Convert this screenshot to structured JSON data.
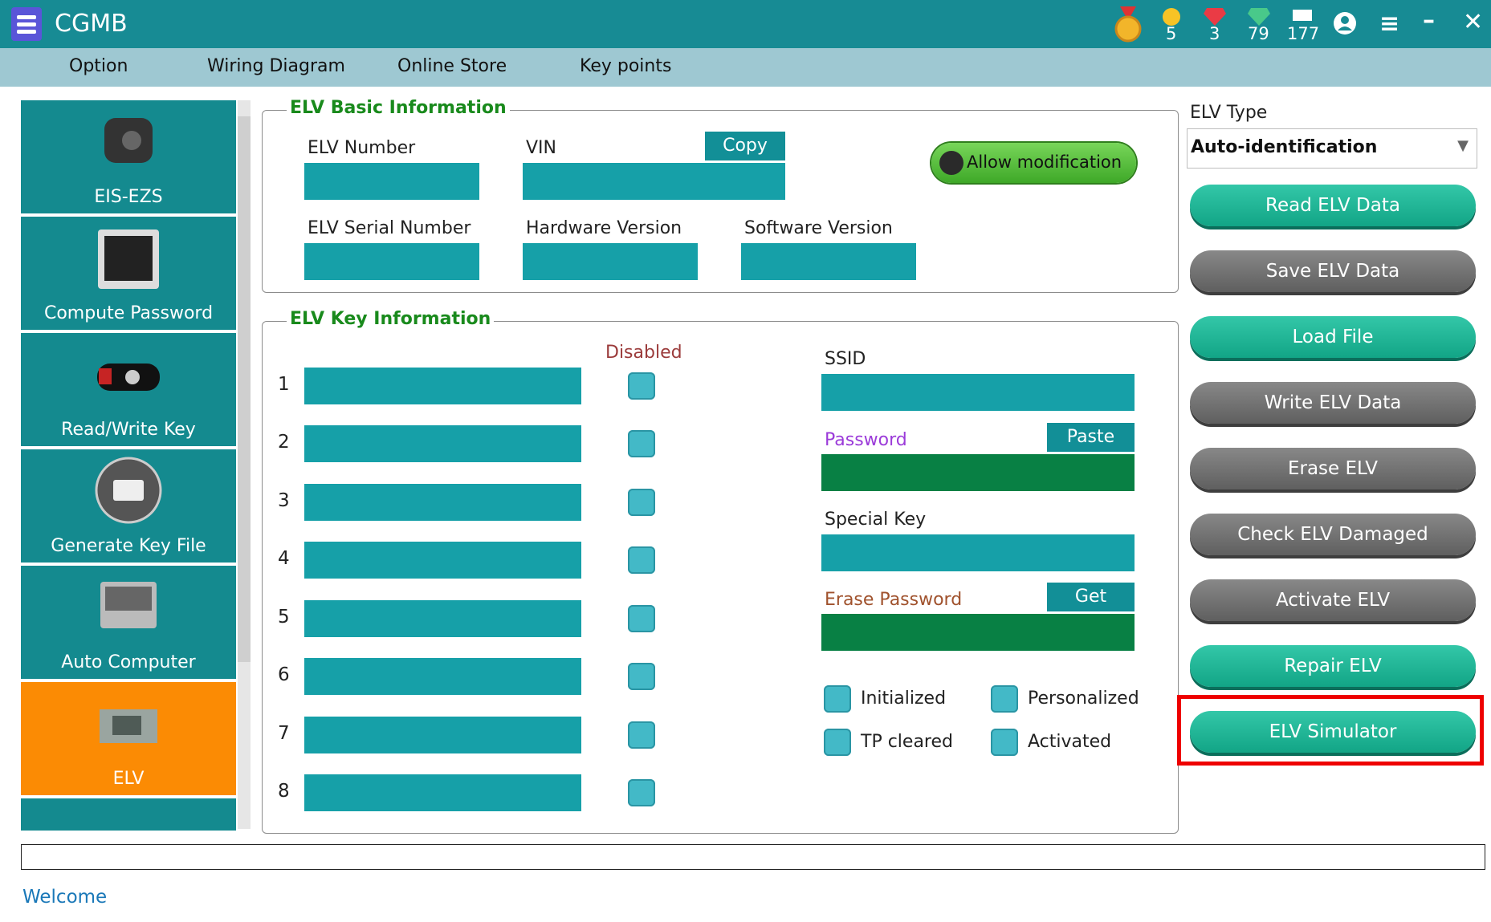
{
  "app": {
    "title": "CGMB"
  },
  "titlebar": {
    "counters": [
      {
        "icon": "medal-icon",
        "value": ""
      },
      {
        "icon": "gold-coin-icon",
        "value": "5"
      },
      {
        "icon": "red-gem-icon",
        "value": "3"
      },
      {
        "icon": "green-gem-icon",
        "value": "79"
      },
      {
        "icon": "chip-icon",
        "value": "177"
      }
    ]
  },
  "menu": {
    "items": [
      "Option",
      "Wiring Diagram",
      "Online Store",
      "Key points"
    ]
  },
  "sidebar": {
    "items": [
      {
        "label": "EIS-EZS",
        "icon": "ignition-switch-icon"
      },
      {
        "label": "Compute Password",
        "icon": "binary-chip-icon"
      },
      {
        "label": "Read/Write Key",
        "icon": "car-key-icon"
      },
      {
        "label": "Generate Key File",
        "icon": "printer-icon"
      },
      {
        "label": "Auto Computer",
        "icon": "ecu-icon"
      },
      {
        "label": "ELV",
        "icon": "elv-module-icon",
        "active": true
      }
    ]
  },
  "basic_info": {
    "title": "ELV Basic Information",
    "elv_number_label": "ELV Number",
    "vin_label": "VIN",
    "copy_label": "Copy",
    "allow_mod_label": "Allow modification",
    "serial_label": "ELV Serial Number",
    "hw_label": "Hardware Version",
    "sw_label": "Software Version"
  },
  "key_info": {
    "title": "ELV Key Information",
    "disabled_label": "Disabled",
    "rows": [
      "1",
      "2",
      "3",
      "4",
      "5",
      "6",
      "7",
      "8"
    ],
    "ssid_label": "SSID",
    "password_label": "Password",
    "paste_label": "Paste",
    "special_key_label": "Special Key",
    "erase_password_label": "Erase Password",
    "get_label": "Get",
    "status": {
      "initialized": "Initialized",
      "personalized": "Personalized",
      "tp_cleared": "TP cleared",
      "activated": "Activated"
    }
  },
  "elv_type": {
    "label": "ELV Type",
    "selected": "Auto-identification"
  },
  "actions": [
    {
      "label": "Read ELV Data",
      "style": "teal"
    },
    {
      "label": "Save ELV Data",
      "style": "gray"
    },
    {
      "label": "Load File",
      "style": "teal"
    },
    {
      "label": "Write ELV Data",
      "style": "gray"
    },
    {
      "label": "Erase ELV",
      "style": "gray"
    },
    {
      "label": "Check ELV Damaged",
      "style": "gray"
    },
    {
      "label": "Activate ELV",
      "style": "gray"
    },
    {
      "label": "Repair ELV",
      "style": "teal"
    },
    {
      "label": "ELV Simulator",
      "style": "teal",
      "highlighted": true
    }
  ],
  "status_bar": {
    "text": "Welcome"
  },
  "colors": {
    "titlebar": "#178b94",
    "teal_field": "#16a0a8",
    "green_field": "#088044",
    "active_sidebar": "#fb8b04",
    "highlight": "#ee0000"
  }
}
